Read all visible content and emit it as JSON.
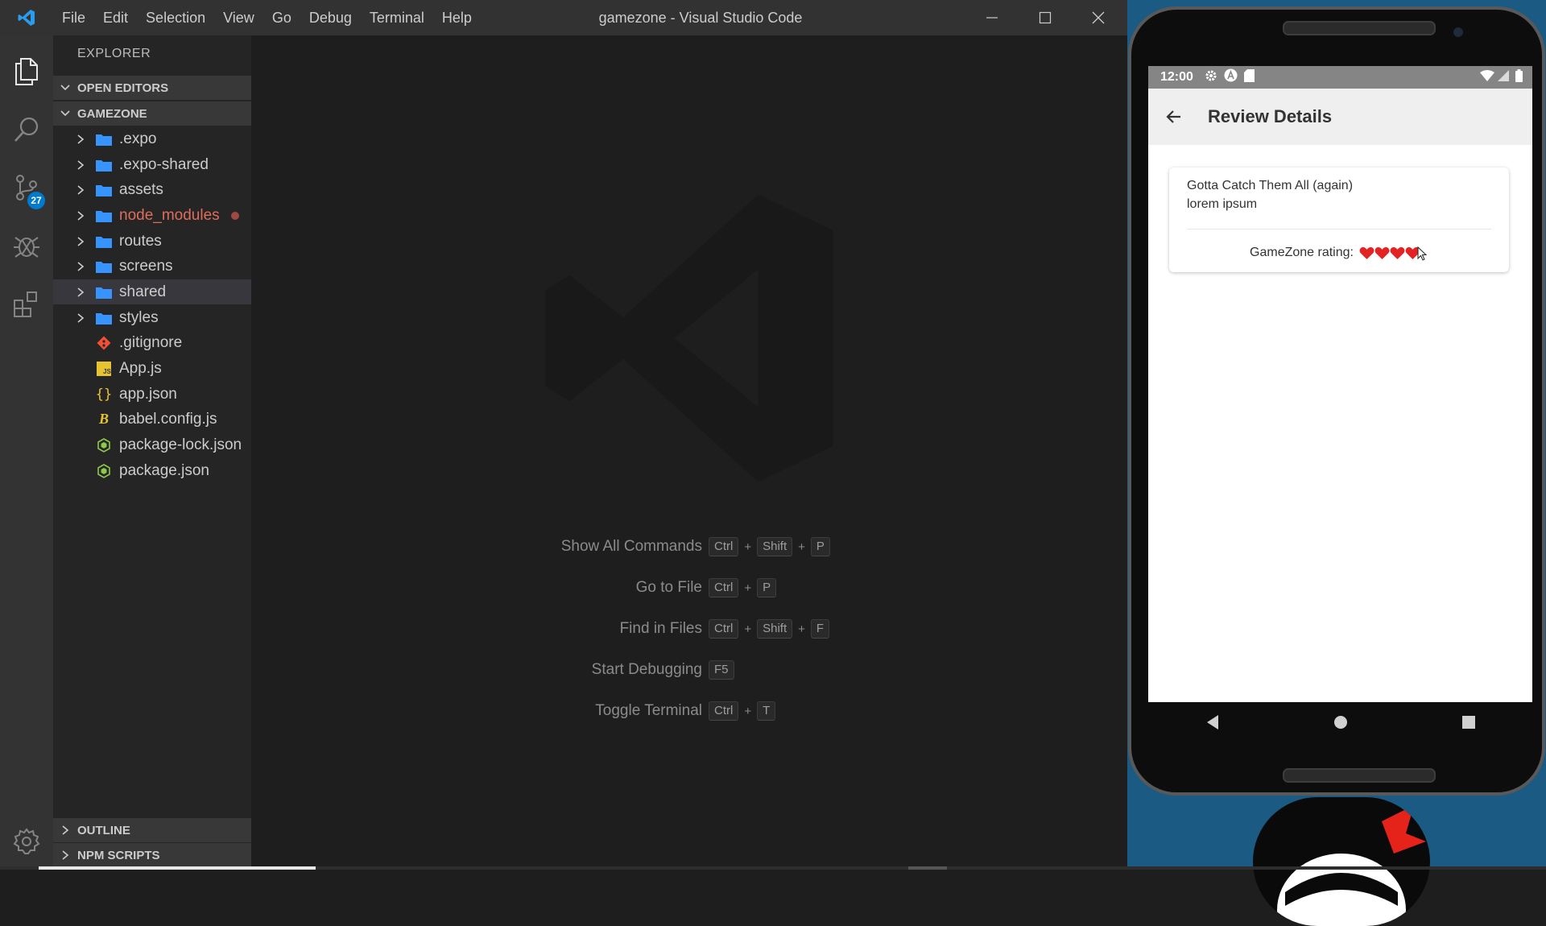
{
  "window": {
    "title": "gamezone - Visual Studio Code",
    "menu": [
      "File",
      "Edit",
      "Selection",
      "View",
      "Go",
      "Debug",
      "Terminal",
      "Help"
    ]
  },
  "activity": {
    "scm_badge": "27"
  },
  "sidebar": {
    "title": "EXPLORER",
    "open_editors": "OPEN EDITORS",
    "project": "GAMEZONE",
    "folders": [
      ".expo",
      ".expo-shared",
      "assets",
      "node_modules",
      "routes",
      "screens",
      "shared",
      "styles"
    ],
    "files": [
      ".gitignore",
      "App.js",
      "app.json",
      "babel.config.js",
      "package-lock.json",
      "package.json"
    ],
    "outline": "OUTLINE",
    "npm_scripts": "NPM SCRIPTS"
  },
  "editor": {
    "shortcuts": [
      {
        "label": "Show All Commands",
        "keys": [
          "Ctrl",
          "Shift",
          "P"
        ]
      },
      {
        "label": "Go to File",
        "keys": [
          "Ctrl",
          "P"
        ]
      },
      {
        "label": "Find in Files",
        "keys": [
          "Ctrl",
          "Shift",
          "F"
        ]
      },
      {
        "label": "Start Debugging",
        "keys": [
          "F5"
        ]
      },
      {
        "label": "Toggle Terminal",
        "keys": [
          "Ctrl",
          "T"
        ]
      }
    ]
  },
  "phone": {
    "time": "12:00",
    "app_title": "Review Details",
    "card": {
      "title": "Gotta Catch Them All (again)",
      "body": "lorem ipsum",
      "rating_label": "GameZone rating:",
      "rating": 4
    }
  },
  "colors": {
    "accent": "#007acc",
    "folder": "#3794ff",
    "modified": "#e06c5a",
    "heart": "#e52222"
  }
}
